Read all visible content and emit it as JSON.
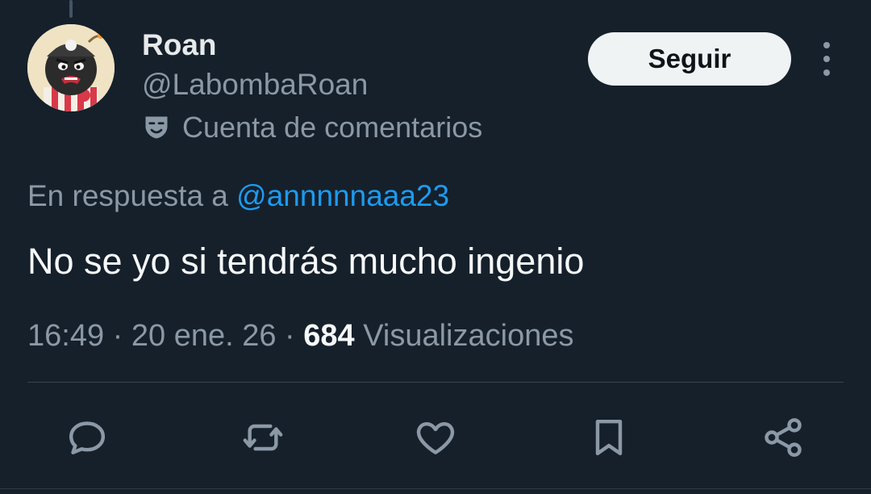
{
  "tweet": {
    "author": {
      "display_name": "Roan",
      "handle": "@LabombaRoan",
      "account_note": "Cuenta de comentarios",
      "account_note_icon": "theater-mask-icon"
    },
    "follow_label": "Seguir",
    "reply_prefix": "En respuesta a",
    "reply_mention": "@annnnnaaa23",
    "text": "No se yo si tendrás mucho ingenio",
    "time": "16:49",
    "date": "20 ene. 26",
    "separator": "·",
    "views_count": "684",
    "views_label": "Visualizaciones"
  },
  "actions": [
    {
      "name": "reply",
      "icon": "reply-icon"
    },
    {
      "name": "retweet",
      "icon": "retweet-icon"
    },
    {
      "name": "like",
      "icon": "heart-icon"
    },
    {
      "name": "bookmark",
      "icon": "bookmark-icon"
    },
    {
      "name": "share",
      "icon": "share-icon"
    }
  ],
  "colors": {
    "background": "#15202b",
    "primary_text": "#e7e9ea",
    "secondary_text": "#8b98a5",
    "link": "#1d9bf0",
    "follow_button_bg": "#eff3f4"
  }
}
